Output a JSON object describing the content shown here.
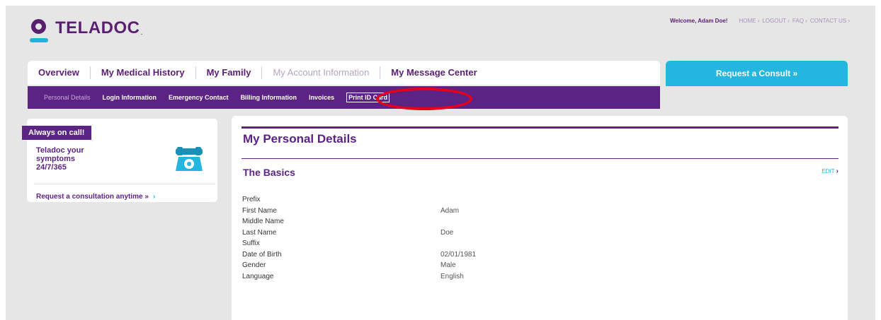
{
  "brand": {
    "name": "TELADOC",
    "dot": "."
  },
  "header": {
    "welcome": "Welcome, Adam Doe!",
    "links": [
      {
        "label": "HOME"
      },
      {
        "label": "LOGOUT"
      },
      {
        "label": "FAQ"
      },
      {
        "label": "CONTACT US"
      }
    ],
    "link_arrow": "›"
  },
  "nav": {
    "tabs": [
      {
        "label": "Overview"
      },
      {
        "label": "My Medical History"
      },
      {
        "label": "My Family"
      },
      {
        "label": "My Account Information"
      },
      {
        "label": "My Message Center"
      }
    ],
    "consult_button": "Request a Consult »"
  },
  "subnav": {
    "tabs": [
      {
        "label": "Personal Details"
      },
      {
        "label": "Login Information"
      },
      {
        "label": "Emergency Contact"
      },
      {
        "label": "Billing Information"
      },
      {
        "label": "Invoices"
      },
      {
        "label": "Print ID Card"
      }
    ]
  },
  "sidebar_card": {
    "tab_label": "Always on call!",
    "text": "Teladoc your symptoms 24/7/365",
    "link": "Request a consultation anytime »",
    "link_chevron": "›"
  },
  "main": {
    "title": "My Personal Details",
    "section_title": "The Basics",
    "edit_label": "EDIT",
    "edit_chevron": "›",
    "fields": [
      {
        "label": "Prefix",
        "value": ""
      },
      {
        "label": "First Name",
        "value": "Adam"
      },
      {
        "label": "Middle Name",
        "value": ""
      },
      {
        "label": "Last Name",
        "value": "Doe"
      },
      {
        "label": "Suffix",
        "value": ""
      },
      {
        "label": "Date of Birth",
        "value": "02/01/1981"
      },
      {
        "label": "Gender",
        "value": "Male"
      },
      {
        "label": "Language",
        "value": "English"
      }
    ]
  },
  "colors": {
    "brand_purple": "#5b2383",
    "accent_blue": "#24b6df",
    "annotation_red": "#e6001a",
    "background": "#e6e6e6"
  }
}
